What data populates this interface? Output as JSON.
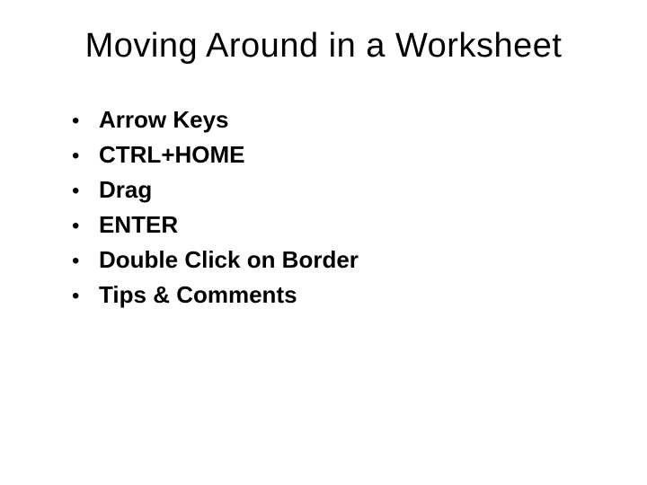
{
  "slide": {
    "title": "Moving Around in a Worksheet",
    "bullets": [
      "Arrow Keys",
      "CTRL+HOME",
      "Drag",
      "ENTER",
      "Double Click on Border",
      "Tips & Comments"
    ]
  }
}
